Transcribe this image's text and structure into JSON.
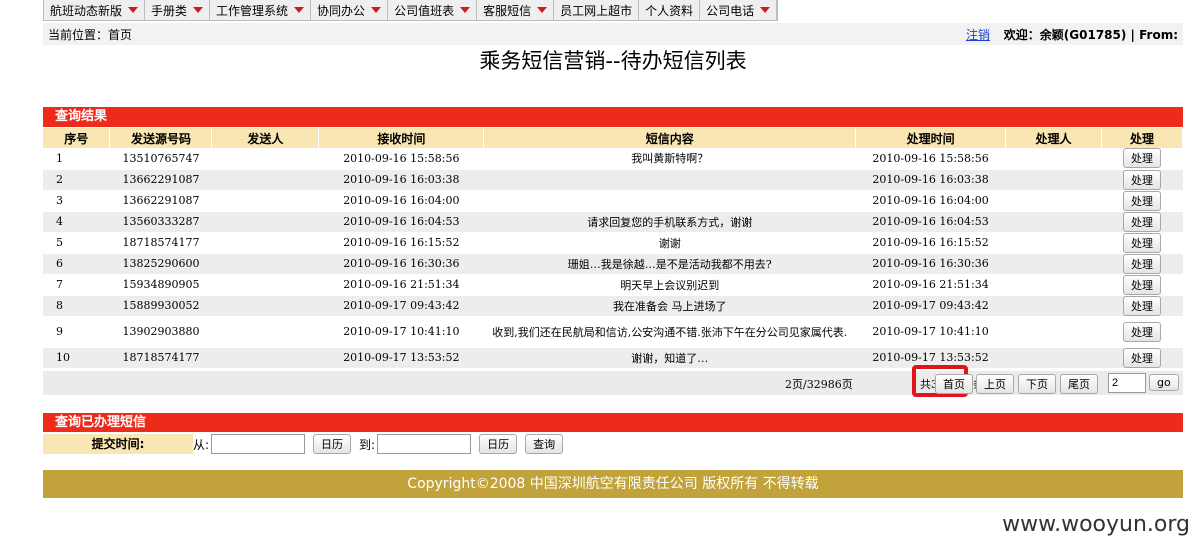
{
  "nav": [
    {
      "label": "航班动态新版",
      "caret": true
    },
    {
      "label": "手册类",
      "caret": true
    },
    {
      "label": "工作管理系统",
      "caret": true
    },
    {
      "label": "协同办公",
      "caret": true
    },
    {
      "label": "公司值班表",
      "caret": true
    },
    {
      "label": "客服短信",
      "caret": true
    },
    {
      "label": "员工网上超市",
      "caret": false
    },
    {
      "label": "个人资料",
      "caret": false
    },
    {
      "label": "公司电话",
      "caret": true
    }
  ],
  "location": {
    "text": "当前位置：首页",
    "logout": "注销",
    "welcome": "欢迎：余颖(G01785) | From:"
  },
  "title": "乘务短信营销--待办短信列表",
  "results": {
    "section_title": "查询结果",
    "headers": [
      "序号",
      "发送源号码",
      "发送人",
      "接收时间",
      "短信内容",
      "处理时间",
      "处理人",
      "处理"
    ],
    "rows": [
      {
        "seq": "1",
        "phone": "13510765747",
        "sender": "",
        "recv": "2010-09-16 15:58:56",
        "content": "我叫黄斯特啊？",
        "proc": "2010-09-16 15:58:56",
        "handler": "",
        "action": "处理"
      },
      {
        "seq": "2",
        "phone": "13662291087",
        "sender": "",
        "recv": "2010-09-16 16:03:38",
        "content": "",
        "proc": "2010-09-16 16:03:38",
        "handler": "",
        "action": "处理"
      },
      {
        "seq": "3",
        "phone": "13662291087",
        "sender": "",
        "recv": "2010-09-16 16:04:00",
        "content": "",
        "proc": "2010-09-16 16:04:00",
        "handler": "",
        "action": "处理"
      },
      {
        "seq": "4",
        "phone": "13560333287",
        "sender": "",
        "recv": "2010-09-16 16:04:53",
        "content": "请求回复您的手机联系方式，谢谢",
        "proc": "2010-09-16 16:04:53",
        "handler": "",
        "action": "处理"
      },
      {
        "seq": "5",
        "phone": "18718574177",
        "sender": "",
        "recv": "2010-09-16 16:15:52",
        "content": "谢谢",
        "proc": "2010-09-16 16:15:52",
        "handler": "",
        "action": "处理"
      },
      {
        "seq": "6",
        "phone": "13825290600",
        "sender": "",
        "recv": "2010-09-16 16:30:36",
        "content": "珊姐…我是徐越…是不是活动我都不用去?",
        "proc": "2010-09-16 16:30:36",
        "handler": "",
        "action": "处理"
      },
      {
        "seq": "7",
        "phone": "15934890905",
        "sender": "",
        "recv": "2010-09-16 21:51:34",
        "content": "明天早上会议别迟到",
        "proc": "2010-09-16 21:51:34",
        "handler": "",
        "action": "处理"
      },
      {
        "seq": "8",
        "phone": "15889930052",
        "sender": "",
        "recv": "2010-09-17 09:43:42",
        "content": "我在准备会 马上进场了",
        "proc": "2010-09-17 09:43:42",
        "handler": "",
        "action": "处理"
      },
      {
        "seq": "9",
        "phone": "13902903880",
        "sender": "",
        "recv": "2010-09-17 10:41:10",
        "content": "收到,我们还在民航局和信访,公安沟通不错.张沛下午在分公司见家属代表.",
        "proc": "2010-09-17 10:41:10",
        "handler": "",
        "action": "处理"
      },
      {
        "seq": "10",
        "phone": "18718574177",
        "sender": "",
        "recv": "2010-09-17 13:53:52",
        "content": "谢谢，知道了…",
        "proc": "2010-09-17 13:53:52",
        "handler": "",
        "action": "处理"
      }
    ]
  },
  "pager": {
    "info": "2页/32986页",
    "total": "共329859条",
    "first": "首页",
    "prev": "上页",
    "next": "下页",
    "last": "尾页",
    "page_value": "2",
    "go": "go"
  },
  "handled": {
    "section_title": "查询已办理短信",
    "submit_label": "提交时间:",
    "from": "从:",
    "calendar1": "日历",
    "to": "到:",
    "calendar2": "日历",
    "query": "查询"
  },
  "footer": "Copyright©2008 中国深圳航空有限责任公司 版权所有 不得转载",
  "watermark": "www.wooyun.org"
}
